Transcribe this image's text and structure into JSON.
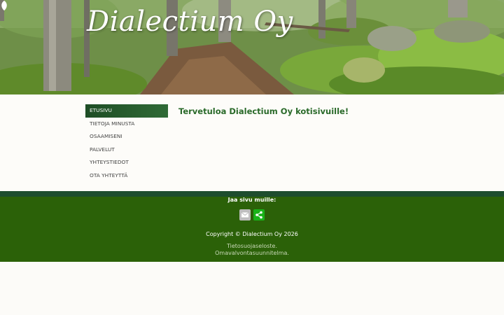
{
  "header": {
    "logo_text": "Dialectium Oy"
  },
  "nav": {
    "items": [
      {
        "label": "ETUSIVU",
        "active": true
      },
      {
        "label": "TIETOJA MINUSTA",
        "active": false
      },
      {
        "label": "OSAAMISENI",
        "active": false
      },
      {
        "label": "PALVELUT",
        "active": false
      },
      {
        "label": "YHTEYSTIEDOT",
        "active": false
      },
      {
        "label": "OTA YHTEYTTÄ",
        "active": false
      }
    ]
  },
  "main": {
    "welcome": "Tervetuloa Dialectium Oy kotisivuille!"
  },
  "footer": {
    "share_label": "Jaa sivu muille:",
    "share_icons": [
      "email-icon",
      "share-icon"
    ],
    "copyright": "Copyright © Dialectium Oy 2026",
    "links": [
      "Tietosuojaseloste.",
      "Omavalvontasuunnitelma."
    ]
  },
  "colors": {
    "nav_active": "#2f6a36",
    "footer_bg": "#2b6108",
    "welcome_text": "#2a6a2a",
    "share_green": "#19b319"
  }
}
